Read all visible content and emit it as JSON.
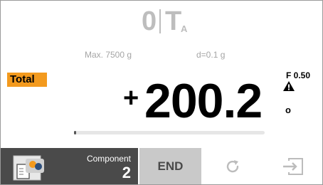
{
  "status": {
    "zero": "0",
    "tare": "T",
    "tare_sub": "A"
  },
  "capacity": {
    "max": "Max. 7500 g",
    "d": "d=0.1 g"
  },
  "mode_badge": "Total",
  "weight": {
    "sign": "+",
    "value": "200.2"
  },
  "side_info": {
    "f_value": "F 0.50",
    "o_label": "o"
  },
  "progress": {
    "fraction": 0.01
  },
  "bottom_bar": {
    "component_label": "Component",
    "component_number": "2",
    "end_label": "END"
  },
  "colors": {
    "accent": "#f39a1e",
    "dark_button": "#4a4a4a",
    "end_button": "#c9c9c9"
  },
  "icons": [
    "component-icon",
    "refresh-icon",
    "exit-icon",
    "warning-icon"
  ]
}
